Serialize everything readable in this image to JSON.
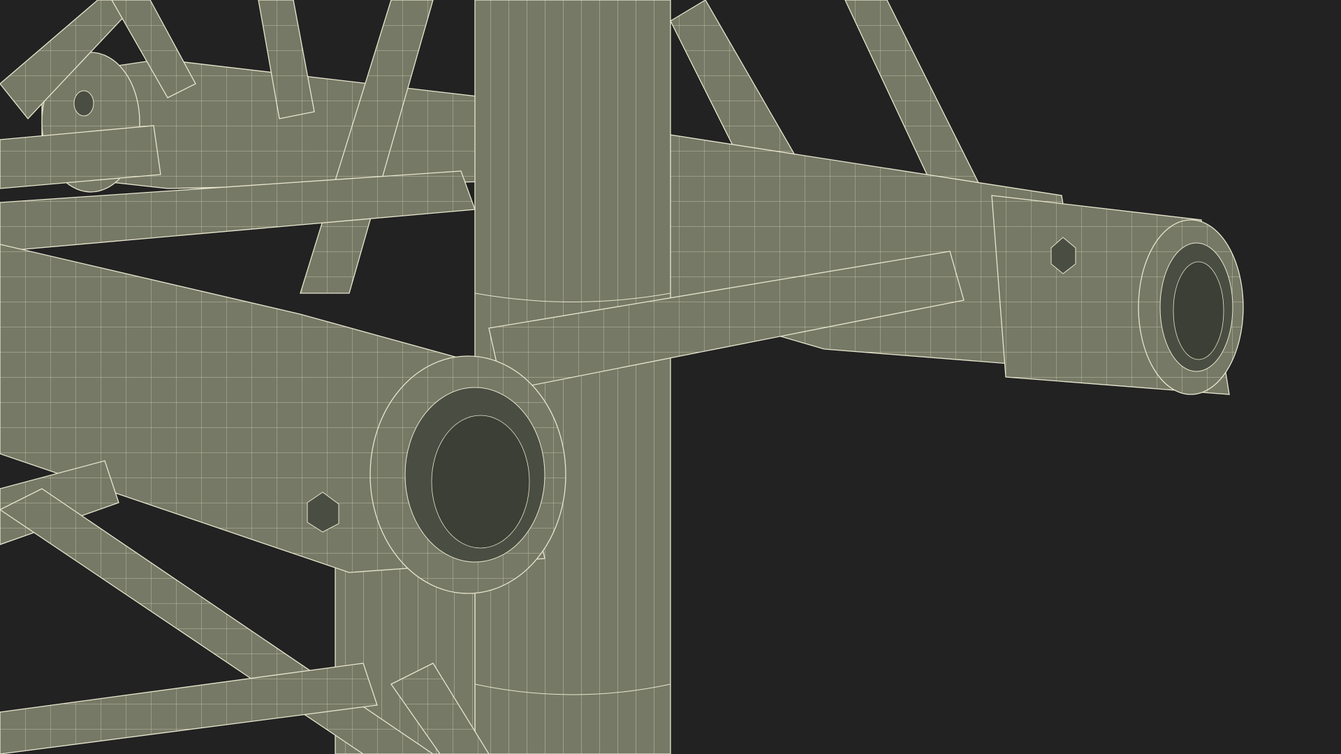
{
  "scene": {
    "subject": "truss-junction-wireframe",
    "background_color": "#222222",
    "tube_color": "#767965",
    "tube_shadow_color": "#5f6354",
    "wire_color": "#e8e6cf",
    "inner_color": "#4a4d42"
  }
}
